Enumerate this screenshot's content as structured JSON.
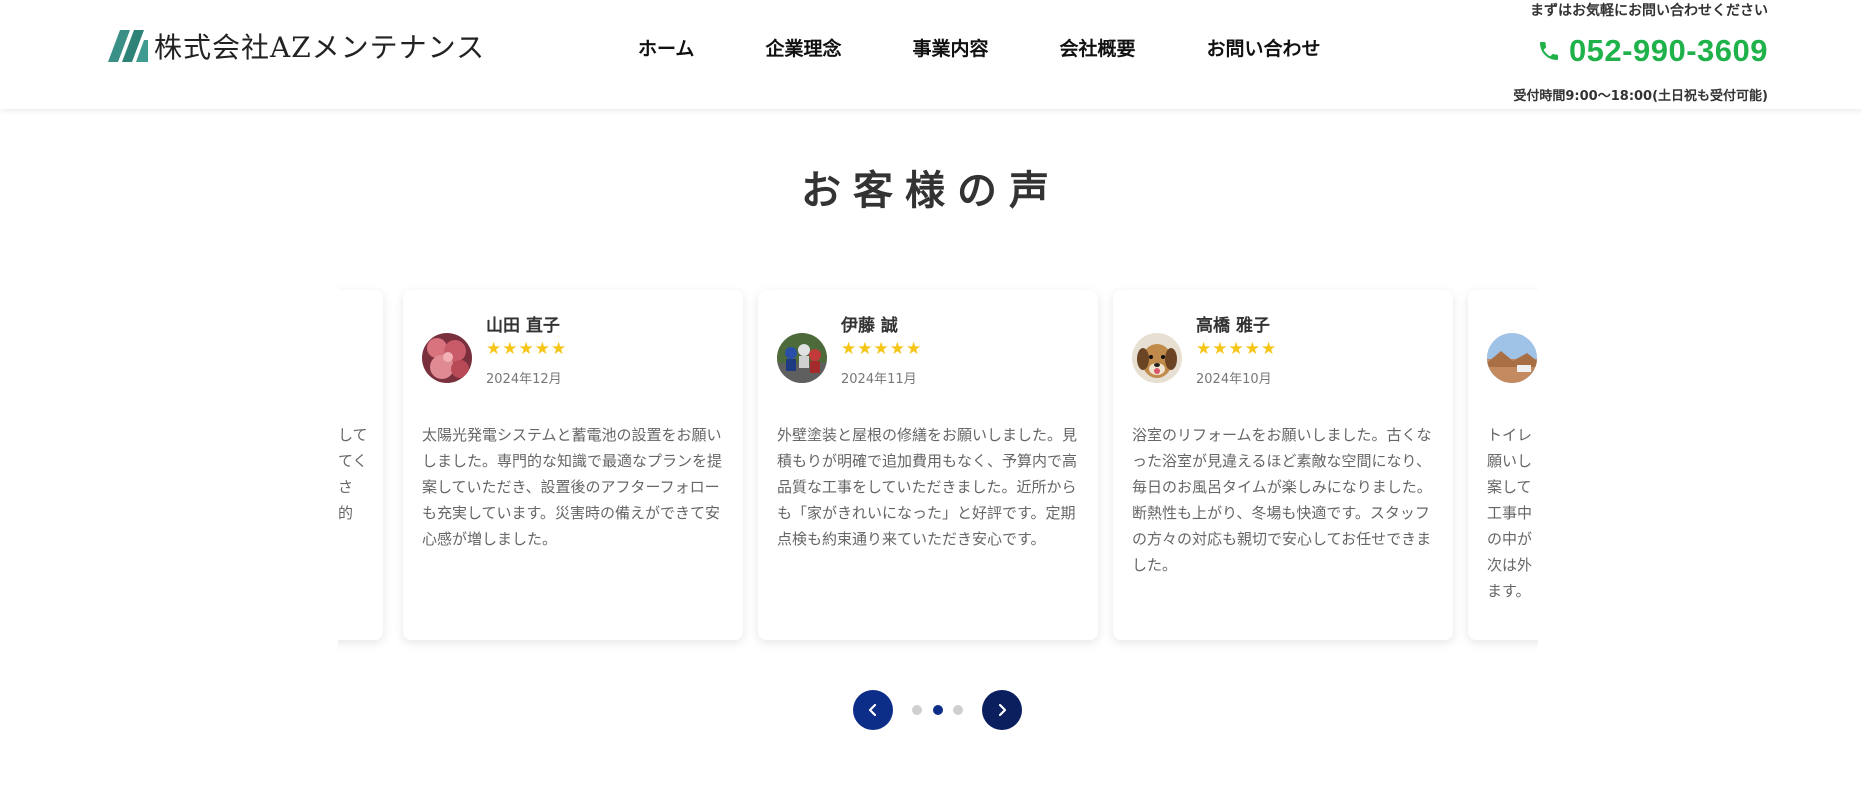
{
  "header": {
    "logo_text": "株式会社AZメンテナンス",
    "nav": [
      {
        "label": "ホーム"
      },
      {
        "label": "企業理念"
      },
      {
        "label": "事業内容"
      },
      {
        "label": "会社概要"
      },
      {
        "label": "お問い合わせ"
      }
    ],
    "contact": {
      "lead": "まずはお気軽にお問い合わせください",
      "phone": "052-990-3609",
      "hours": "受付時間9:00〜18:00(土日祝も受付可能)"
    }
  },
  "section": {
    "title": "お客様の声"
  },
  "testimonials": [
    {
      "name": "",
      "stars": "",
      "date": "",
      "text": "して\nてく\nさ\n的"
    },
    {
      "name": "山田 直子",
      "stars": "★★★★★",
      "date": "2024年12月",
      "text": "太陽光発電システムと蓄電池の設置をお願いしました。専門的な知識で最適なプランを提案していただき、設置後のアフターフォローも充実しています。災害時の備えができて安心感が増しました。"
    },
    {
      "name": "伊藤 誠",
      "stars": "★★★★★",
      "date": "2024年11月",
      "text": "外壁塗装と屋根の修繕をお願いしました。見積もりが明確で追加費用もなく、予算内で高品質な工事をしていただきました。近所からも「家がきれいになった」と好評です。定期点検も約束通り来ていただき安心です。"
    },
    {
      "name": "高橋 雅子",
      "stars": "★★★★★",
      "date": "2024年10月",
      "text": "浴室のリフォームをお願いしました。古くなった浴室が見違えるほど素敵な空間になり、毎日のお風呂タイムが楽しみになりました。断熱性も上がり、冬場も快適です。スタッフの方々の対応も親切で安心してお任せできました。"
    },
    {
      "name": "",
      "stars": "",
      "date": "",
      "text": "トイレ\n願いし\n案して\n工事中\nの中が\n次は外\nます。"
    }
  ],
  "pager": {
    "active_index": 1,
    "dot_count": 3
  },
  "colors": {
    "phone_green": "#1fb24a",
    "star_gold": "#f5c518",
    "pager_navy": "#0c2d88"
  },
  "icons": {
    "logo": "slanted-stripes-logo-icon",
    "phone": "phone-icon",
    "prev": "chevron-left-icon",
    "next": "chevron-right-icon"
  }
}
